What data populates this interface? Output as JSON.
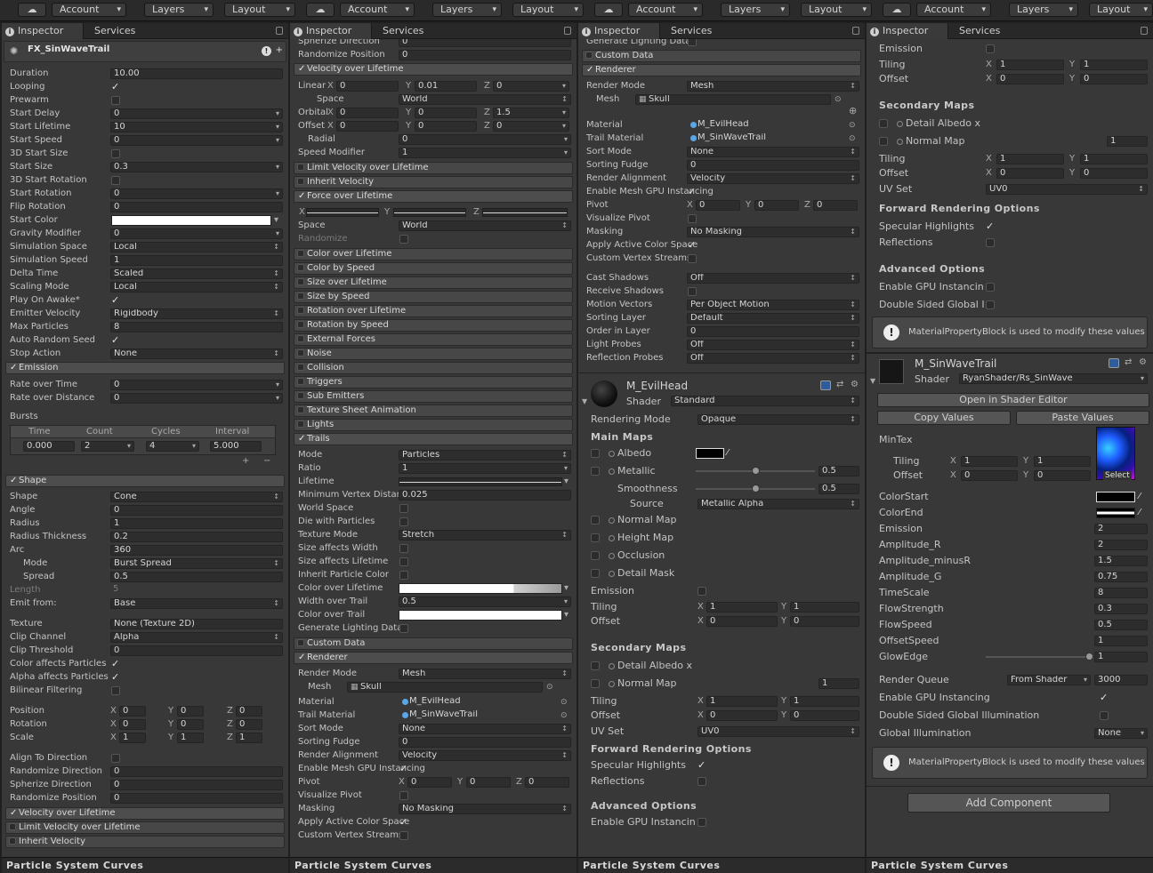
{
  "toolbar": {
    "groups": [
      {
        "account": "Account",
        "layers": "Layers",
        "layout": "Layout"
      },
      {
        "account": "Account",
        "layers": "Layers",
        "layout": "Layout"
      },
      {
        "account": "Account",
        "layers": "Layers",
        "layout": "Layout"
      },
      {
        "account": "Account",
        "layers": "Layers",
        "layout": "Layout"
      }
    ]
  },
  "tabs": {
    "inspector": "Inspector",
    "services": "Services"
  },
  "footer": "Particle System Curves",
  "p1": {
    "title": "FX_SinWaveTrail",
    "rows": [
      [
        "Duration",
        "10.00"
      ],
      [
        "Looping",
        ""
      ],
      [
        "Prewarm",
        ""
      ],
      [
        "Start Delay",
        "0"
      ],
      [
        "Start Lifetime",
        "10"
      ],
      [
        "Start Speed",
        "0"
      ],
      [
        "3D Start Size",
        ""
      ],
      [
        "Start Size",
        "0.3"
      ],
      [
        "3D Start Rotation",
        ""
      ],
      [
        "Start Rotation",
        "0"
      ],
      [
        "Flip Rotation",
        "0"
      ],
      [
        "Start Color",
        ""
      ],
      [
        "Gravity Modifier",
        "0"
      ],
      [
        "Simulation Space",
        "Local"
      ],
      [
        "Simulation Speed",
        "1"
      ],
      [
        "Delta Time",
        "Scaled"
      ],
      [
        "Scaling Mode",
        "Local"
      ],
      [
        "Play On Awake*",
        ""
      ],
      [
        "Emitter Velocity",
        "Rigidbody"
      ],
      [
        "Max Particles",
        "8"
      ],
      [
        "Auto Random Seed",
        ""
      ],
      [
        "Stop Action",
        "None"
      ]
    ],
    "emission": "Emission",
    "rate_time": [
      "Rate over Time",
      "0"
    ],
    "rate_dist": [
      "Rate over Distance",
      "0"
    ],
    "bursts": "Bursts",
    "bursts_head": [
      "Time",
      "Count",
      "Cycles",
      "Interval"
    ],
    "bursts_row": [
      "0.000",
      "2",
      "4",
      "5.000"
    ],
    "shape": "Shape",
    "shape_rows": [
      [
        "Shape",
        "Cone"
      ],
      [
        "Angle",
        "0"
      ],
      [
        "Radius",
        "1"
      ],
      [
        "Radius Thickness",
        "0.2"
      ],
      [
        "Arc",
        "360"
      ],
      [
        "Mode",
        "Burst Spread"
      ],
      [
        "Spread",
        "0.5"
      ],
      [
        "Length",
        "5"
      ],
      [
        "Emit from:",
        "Base"
      ]
    ],
    "tex_rows": [
      [
        "Texture",
        "None (Texture 2D)"
      ],
      [
        "Clip Channel",
        "Alpha"
      ],
      [
        "Clip Threshold",
        "0"
      ],
      [
        "Color affects Particles",
        ""
      ],
      [
        "Alpha affects Particles",
        ""
      ],
      [
        "Bilinear Filtering",
        ""
      ]
    ],
    "pos": {
      "label": "Position",
      "x": "0",
      "y": "0",
      "z": "0"
    },
    "rot": {
      "label": "Rotation",
      "x": "0",
      "y": "0",
      "z": "0"
    },
    "scale": {
      "label": "Scale",
      "x": "1",
      "y": "1",
      "z": "1"
    },
    "align_rows": [
      [
        "Align To Direction",
        ""
      ],
      [
        "Randomize Direction",
        "0"
      ],
      [
        "Spherize Direction",
        "0"
      ],
      [
        "Randomize Position",
        "0"
      ]
    ],
    "mods": [
      "Velocity over Lifetime",
      "Limit Velocity over Lifetime",
      "Inherit Velocity"
    ]
  },
  "p2": {
    "top": [
      [
        "Spherize Direction",
        "0"
      ],
      [
        "Randomize Position",
        "0"
      ]
    ],
    "vol": "Velocity over Lifetime",
    "linear": {
      "label": "Linear",
      "x": "0",
      "y": "0.01",
      "z": "0"
    },
    "space": [
      "Space",
      "World"
    ],
    "orbital": {
      "label": "Orbital",
      "x": "0",
      "y": "0",
      "z": "1.5"
    },
    "offset": {
      "label": "Offset",
      "x": "0",
      "y": "0",
      "z": "0"
    },
    "radial": [
      "Radial",
      "0"
    ],
    "speedmod": [
      "Speed Modifier",
      "1"
    ],
    "limit": "Limit Velocity over Lifetime",
    "inherit": "Inherit Velocity",
    "force": "Force over Lifetime",
    "fspace": [
      "Space",
      "World"
    ],
    "randomize": "Randomize",
    "mods": [
      "Color over Lifetime",
      "Color by Speed",
      "Size over Lifetime",
      "Size by Speed",
      "Rotation over Lifetime",
      "Rotation by Speed",
      "External Forces",
      "Noise",
      "Collision",
      "Triggers",
      "Sub Emitters",
      "Texture Sheet Animation",
      "Lights"
    ],
    "trails": "Trails",
    "trail_rows": [
      [
        "Mode",
        "Particles"
      ],
      [
        "Ratio",
        "1"
      ],
      [
        "Lifetime",
        ""
      ],
      [
        "Minimum Vertex Distance",
        "0.025"
      ],
      [
        "World Space",
        ""
      ],
      [
        "Die with Particles",
        ""
      ],
      [
        "Texture Mode",
        "Stretch"
      ],
      [
        "Size affects Width",
        ""
      ],
      [
        "Size affects Lifetime",
        ""
      ],
      [
        "Inherit Particle Color",
        ""
      ],
      [
        "Color over Lifetime",
        ""
      ],
      [
        "Width over Trail",
        "0.5"
      ],
      [
        "Color over Trail",
        ""
      ],
      [
        "Generate Lighting Data",
        ""
      ]
    ],
    "custom": "Custom Data",
    "renderer": "Renderer",
    "r_rows": [
      [
        "Render Mode",
        "Mesh"
      ],
      [
        "Mesh",
        "Skull"
      ]
    ],
    "r2": [
      [
        "Material",
        "M_EvilHead"
      ],
      [
        "Trail Material",
        "M_SinWaveTrail"
      ],
      [
        "Sort Mode",
        "None"
      ],
      [
        "Sorting Fudge",
        "0"
      ],
      [
        "Render Alignment",
        "Velocity"
      ],
      [
        "Enable Mesh GPU Instancing",
        ""
      ]
    ],
    "pivot": {
      "label": "Pivot",
      "x": "0",
      "y": "0",
      "z": "0"
    },
    "r3": [
      [
        "Visualize Pivot",
        ""
      ],
      [
        "Masking",
        "No Masking"
      ],
      [
        "Apply Active Color Space",
        ""
      ],
      [
        "Custom Vertex Streams",
        ""
      ]
    ]
  },
  "p3": {
    "top": [
      "Generate Lighting Data",
      "Custom Data"
    ],
    "renderer": "Renderer",
    "r_rows": [
      [
        "Render Mode",
        "Mesh"
      ],
      [
        "Mesh",
        "Skull"
      ]
    ],
    "r2": [
      [
        "Material",
        "M_EvilHead"
      ],
      [
        "Trail Material",
        "M_SinWaveTrail"
      ],
      [
        "Sort Mode",
        "None"
      ],
      [
        "Sorting Fudge",
        "0"
      ],
      [
        "Render Alignment",
        "Velocity"
      ],
      [
        "Enable Mesh GPU Instancing",
        ""
      ]
    ],
    "pivot": {
      "label": "Pivot",
      "x": "0",
      "y": "0",
      "z": "0"
    },
    "r3": [
      [
        "Visualize Pivot",
        ""
      ],
      [
        "Masking",
        "No Masking"
      ],
      [
        "Apply Active Color Space",
        ""
      ],
      [
        "Custom Vertex Streams",
        ""
      ]
    ],
    "r4": [
      [
        "Cast Shadows",
        "Off"
      ],
      [
        "Receive Shadows",
        ""
      ],
      [
        "Motion Vectors",
        "Per Object Motion"
      ],
      [
        "Sorting Layer",
        "Default"
      ],
      [
        "Order in Layer",
        "0"
      ],
      [
        "Light Probes",
        "Off"
      ],
      [
        "Reflection Probes",
        "Off"
      ]
    ],
    "mat_name": "M_EvilHead",
    "shader_label": "Shader",
    "shader": "Standard",
    "rendering_mode": [
      "Rendering Mode",
      "Opaque"
    ],
    "main_maps": "Main Maps",
    "albedo": "Albedo",
    "metallic": "Metallic",
    "metallic_val": "0.5",
    "smoothness": "Smoothness",
    "smooth_val": "0.5",
    "source": "Source",
    "source_val": "Metallic Alpha",
    "maps": [
      "Normal Map",
      "Height Map",
      "Occlusion",
      "Detail Mask"
    ],
    "emission": "Emission",
    "tiling": {
      "label": "Tiling",
      "x": "1",
      "y": "1"
    },
    "offset": {
      "label": "Offset",
      "x": "0",
      "y": "0"
    },
    "secondary": "Secondary Maps",
    "detail_albedo": "Detail Albedo x",
    "normal2": "Normal Map",
    "normal2_val": "1",
    "tiling2": {
      "label": "Tiling",
      "x": "1",
      "y": "1"
    },
    "offset2": {
      "label": "Offset",
      "x": "0",
      "y": "0"
    },
    "uvset": [
      "UV Set",
      "UV0"
    ],
    "forward": "Forward Rendering Options",
    "spec": "Specular Highlights",
    "refl": "Reflections",
    "advanced": "Advanced Options",
    "gpu": "Enable GPU Instancing"
  },
  "p4": {
    "emission": "Emission",
    "tiling": {
      "label": "Tiling",
      "x": "1",
      "y": "1"
    },
    "offset": {
      "label": "Offset",
      "x": "0",
      "y": "0"
    },
    "secondary": "Secondary Maps",
    "detail_albedo": "Detail Albedo x",
    "normal2": "Normal Map",
    "normal2_val": "1",
    "tiling2": {
      "label": "Tiling",
      "x": "1",
      "y": "1"
    },
    "offset2": {
      "label": "Offset",
      "x": "0",
      "y": "0"
    },
    "uvset": [
      "UV Set",
      "UV0"
    ],
    "forward": "Forward Rendering Options",
    "spec": "Specular Highlights",
    "refl": "Reflections",
    "advanced": "Advanced Options",
    "gpu": "Enable GPU Instancing",
    "dsgi": "Double Sided Global Illumination",
    "help": "MaterialPropertyBlock is used to modify these values",
    "mat_name": "M_SinWaveTrail",
    "shader_label": "Shader",
    "shader": "RyanShader/Rs_SinWave",
    "open_editor": "Open in Shader Editor",
    "copy": "Copy Values",
    "paste": "Paste Values",
    "mintex": "MinTex",
    "select": "Select",
    "mt_tiling": {
      "label": "Tiling",
      "x": "1",
      "y": "1"
    },
    "mt_offset": {
      "label": "Offset",
      "x": "0",
      "y": "0"
    },
    "colorstart": "ColorStart",
    "colorend": "ColorEnd",
    "props": [
      [
        "Emission",
        "2"
      ],
      [
        "Amplitude_R",
        "2"
      ],
      [
        "Amplitude_minusR",
        "1.5"
      ],
      [
        "Amplitude_G",
        "0.75"
      ],
      [
        "TimeScale",
        "8"
      ],
      [
        "FlowStrength",
        "0.3"
      ],
      [
        "FlowSpeed",
        "0.5"
      ],
      [
        "OffsetSpeed",
        "1"
      ],
      [
        "GlowEdge",
        "1"
      ]
    ],
    "queue": [
      "Render Queue",
      "From Shader",
      "3000"
    ],
    "gpu2": "Enable GPU Instancing",
    "dsgi2": "Double Sided Global Illumination",
    "gi": [
      "Global Illumination",
      "None"
    ],
    "add_component": "Add Component"
  },
  "colors": {
    "panel": "#383838",
    "toolbar": "#2a2a2a",
    "field": "#2d2d2d",
    "module": "#474747"
  }
}
